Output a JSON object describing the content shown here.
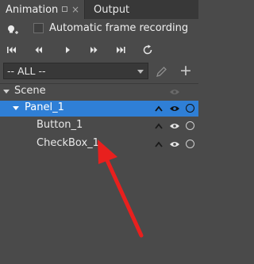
{
  "tabs": {
    "active": "Animation",
    "other": "Output"
  },
  "toolbar": {
    "auto_record_label": "Automatic frame recording"
  },
  "clip_select": {
    "value": "-- ALL --"
  },
  "tree": {
    "items": [
      {
        "label": "Scene"
      },
      {
        "label": "Panel_1"
      },
      {
        "label": "Button_1"
      },
      {
        "label": "CheckBox_1"
      }
    ]
  },
  "colors": {
    "panel_bg": "#4a4a4a",
    "selection": "#2f7fd6",
    "annotation_arrow": "#e8201e"
  },
  "icons": [
    "add-light-icon",
    "record-checkbox",
    "first-frame-icon",
    "prev-frame-icon",
    "play-icon",
    "next-frame-icon",
    "last-frame-icon",
    "loop-icon",
    "dropdown-caret-icon",
    "pencil-icon",
    "plus-icon",
    "expand-arrow-icon",
    "visibility-eye-icon",
    "lock-circle-icon",
    "move-up-chevron-icon"
  ]
}
